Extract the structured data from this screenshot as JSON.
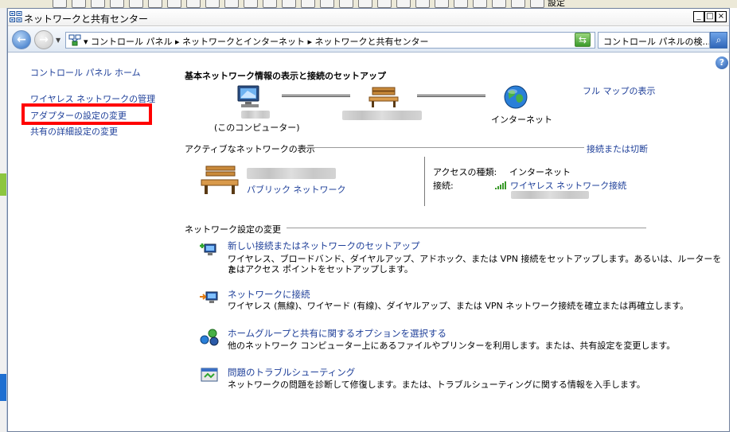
{
  "window": {
    "title": "ネットワークと共有センター",
    "minimize": "_",
    "maximize": "□",
    "close": "×"
  },
  "top_strip": {
    "text": "設定"
  },
  "address": {
    "breadcrumb": "▾ コントロール パネル ▸ ネットワークとインターネット ▸ ネットワークと共有センター",
    "search_placeholder": "コントロール パネルの検..."
  },
  "sidebar": {
    "items": [
      {
        "label": "コントロール パネル ホーム"
      },
      {
        "label": "ワイヤレス ネットワークの管理"
      },
      {
        "label": "アダプターの設定の変更"
      },
      {
        "label": "共有の詳細設定の変更"
      }
    ]
  },
  "main": {
    "heading": "基本ネットワーク情報の表示と接続のセットアップ",
    "full_map": "フル マップの表示",
    "map": {
      "computer_label": "(このコンピューター)",
      "internet_label": "インターネット"
    },
    "active_section": {
      "title": "アクティブなネットワークの表示",
      "connect_link": "接続または切断",
      "network_type": "パブリック ネットワーク",
      "access_type_label": "アクセスの種類:",
      "access_type_value": "インターネット",
      "connection_label": "接続:",
      "connection_value": "ワイヤレス ネットワーク接続"
    },
    "settings_section": {
      "title": "ネットワーク設定の変更",
      "tasks": [
        {
          "title": "新しい接続またはネットワークのセットアップ",
          "desc_line1": "ワイヤレス、ブロードバンド、ダイヤルアップ、アドホック、または VPN 接続をセットアップします。あるいは、ルーターをま",
          "desc_line2": "たはアクセス ポイントをセットアップします。",
          "icon": "new-connection-icon"
        },
        {
          "title": "ネットワークに接続",
          "desc_line1": "ワイヤレス (無線)、ワイヤード (有線)、ダイヤルアップ、または VPN ネットワーク接続を確立または再確立します。",
          "icon": "connect-network-icon"
        },
        {
          "title": "ホームグループと共有に関するオプションを選択する",
          "desc_line1": "他のネットワーク コンピューター上にあるファイルやプリンターを利用します。または、共有設定を変更します。",
          "icon": "homegroup-icon"
        },
        {
          "title": "問題のトラブルシューティング",
          "desc_line1": "ネットワークの問題を診断して修復します。または、トラブルシューティングに関する情報を入手します。",
          "icon": "troubleshoot-icon"
        }
      ]
    }
  }
}
